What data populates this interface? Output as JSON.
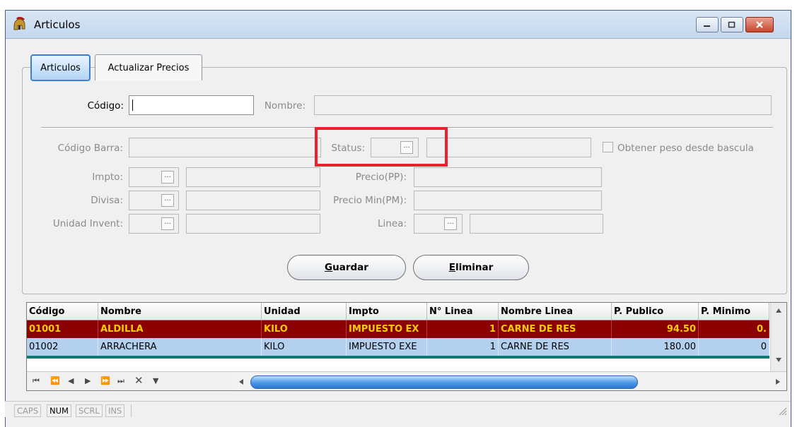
{
  "window": {
    "title": "Articulos",
    "icon": "spartan-helmet-icon",
    "controls": [
      "minimize-icon",
      "maximize-icon",
      "close-icon"
    ]
  },
  "tabs": [
    {
      "label": "Articulos",
      "active": true
    },
    {
      "label": "Actualizar Precios",
      "active": false
    }
  ],
  "form": {
    "codigo_label": "Código:",
    "codigo_value": "",
    "nombre_label": "Nombre:",
    "codigo_barra_label": "Código Barra:",
    "status_label": "Status:",
    "peso_checkbox_label": "Obtener peso desde bascula",
    "impto_label": "Impto:",
    "divisa_label": "Divisa:",
    "unidad_label": "Unidad Invent:",
    "precio_pp_label": "Precio(PP):",
    "precio_pm_label": "Precio Min(PM):",
    "linea_label": "Linea:",
    "lookup_glyph": "..."
  },
  "buttons": {
    "guardar_hotkey": "G",
    "guardar_rest": "uardar",
    "eliminar_hotkey": "E",
    "eliminar_rest": "liminar"
  },
  "grid": {
    "columns": [
      "Código",
      "Nombre",
      "Unidad",
      "Impto",
      "N° Linea",
      "Nombre Linea",
      "P. Publico",
      "P. Minimo"
    ],
    "rows": [
      [
        "01001",
        "ALDILLA",
        "KILO",
        "IMPUESTO EX",
        "1",
        "CARNE DE RES",
        "94.50",
        "0."
      ],
      [
        "01002",
        "ARRACHERA",
        "KILO",
        "IMPUESTO EXE",
        "1",
        "CARNE DE RES",
        "180.00",
        "0"
      ]
    ]
  },
  "statusbar": {
    "items": [
      {
        "label": "CAPS",
        "active": false
      },
      {
        "label": "NUM",
        "active": true
      },
      {
        "label": "SCRL",
        "active": false
      },
      {
        "label": "INS",
        "active": false
      }
    ]
  },
  "colors": {
    "highlight": "#e8232f",
    "selected_row_bg": "#8b0000",
    "selected_row_text": "#ffd000",
    "alt_row_bg": "#b3d0ef"
  }
}
